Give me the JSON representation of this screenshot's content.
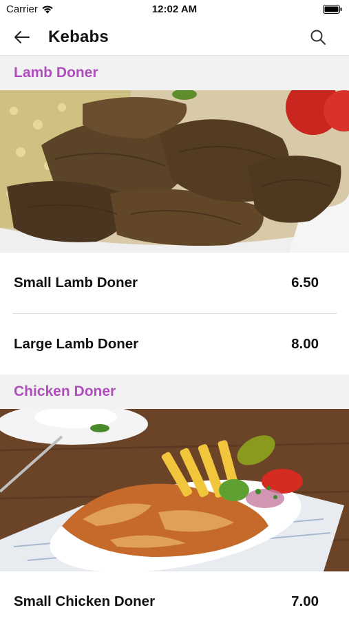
{
  "status_bar": {
    "carrier": "Carrier",
    "time": "12:02 AM"
  },
  "nav": {
    "title": "Kebabs",
    "back_icon": "back-arrow-icon",
    "search_icon": "search-icon"
  },
  "colors": {
    "section_header": "#b04fbc",
    "section_bg": "#f2f2f2"
  },
  "sections": [
    {
      "title": "Lamb Doner",
      "image": "lamb-doner-photo",
      "items": [
        {
          "name": "Small Lamb Doner",
          "price": "6.50"
        },
        {
          "name": "Large Lamb Doner",
          "price": "8.00"
        }
      ]
    },
    {
      "title": "Chicken Doner",
      "image": "chicken-doner-photo",
      "items": [
        {
          "name": "Small Chicken Doner",
          "price": "7.00"
        }
      ]
    }
  ]
}
